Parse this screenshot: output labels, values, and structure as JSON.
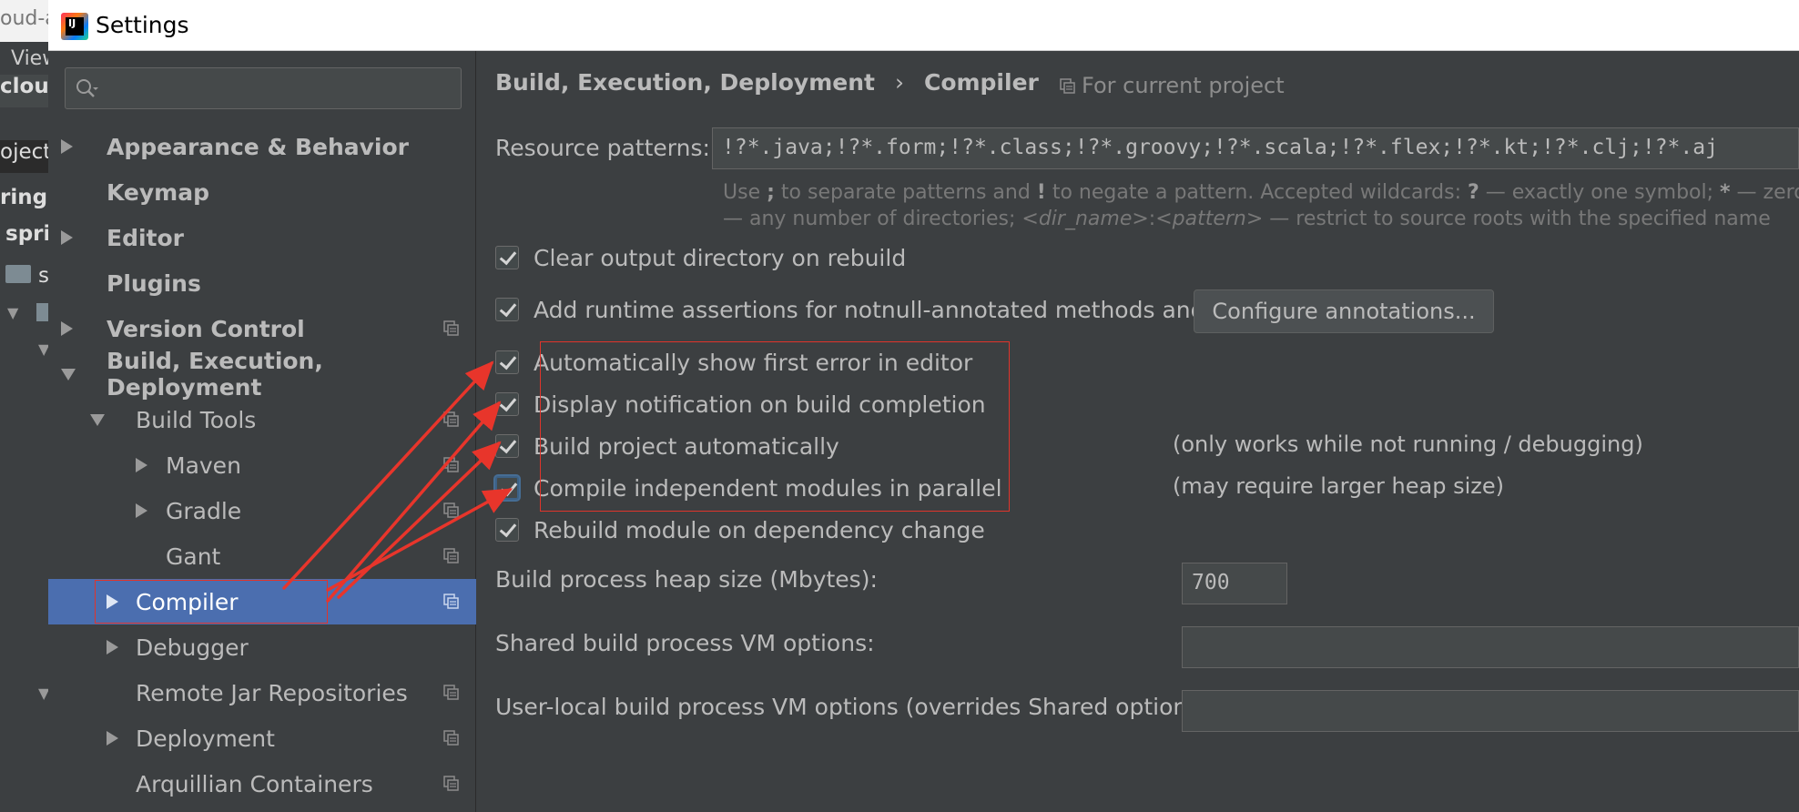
{
  "background_ide": {
    "top_text": "oud-a",
    "menu_item": "View",
    "project_name": "cloud",
    "project_tab": "oject",
    "lines": [
      "ringo",
      "spri",
      "s"
    ]
  },
  "window": {
    "title": "Settings",
    "app_icon_text": "IJ"
  },
  "sidebar": {
    "search_placeholder": "",
    "items": [
      {
        "label": "Appearance & Behavior"
      },
      {
        "label": "Keymap"
      },
      {
        "label": "Editor"
      },
      {
        "label": "Plugins"
      },
      {
        "label": "Version Control"
      },
      {
        "label": "Build, Execution, Deployment"
      },
      {
        "label": "Build Tools"
      },
      {
        "label": "Maven"
      },
      {
        "label": "Gradle"
      },
      {
        "label": "Gant"
      },
      {
        "label": "Compiler"
      },
      {
        "label": "Debugger"
      },
      {
        "label": "Remote Jar Repositories"
      },
      {
        "label": "Deployment"
      },
      {
        "label": "Arquillian Containers"
      }
    ]
  },
  "content": {
    "breadcrumb": {
      "parent": "Build, Execution, Deployment",
      "separator": "›",
      "current": "Compiler"
    },
    "scope_label": "For current project",
    "resource_patterns": {
      "label": "Resource patterns:",
      "value": "!?*.java;!?*.form;!?*.class;!?*.groovy;!?*.scala;!?*.flex;!?*.kt;!?*.clj;!?*.aj",
      "hint_line1_a": "Use ",
      "hint_line1_b": ";",
      "hint_line1_c": " to separate patterns and ",
      "hint_line1_d": "!",
      "hint_line1_e": " to negate a pattern. Accepted wildcards: ",
      "hint_line1_f": "?",
      "hint_line1_g": " — exactly one symbol; ",
      "hint_line1_h": "*",
      "hint_line1_i": " — zero or m",
      "hint_line2_a": "— any number of directories; ",
      "hint_line2_b": "<dir_name>",
      "hint_line2_c": ":",
      "hint_line2_d": "<pattern>",
      "hint_line2_e": " — restrict to source roots with the specified name"
    },
    "options": {
      "clear_output": "Clear output directory on rebuild",
      "runtime_assertions": "Add runtime assertions for notnull-annotated methods and parameters",
      "configure_annotations": "Configure annotations...",
      "show_first_error": "Automatically show first error in editor",
      "display_notification": "Display notification on build completion",
      "build_automatically": "Build project automatically",
      "build_automatically_note": "(only works while not running / debugging)",
      "compile_parallel": "Compile independent modules in parallel",
      "compile_parallel_note": "(may require larger heap size)",
      "rebuild_on_dependency": "Rebuild module on dependency change"
    },
    "heap_size": {
      "label": "Build process heap size (Mbytes):",
      "value": "700"
    },
    "shared_vm": {
      "label": "Shared build process VM options:",
      "value": ""
    },
    "user_vm": {
      "label": "User-local build process VM options (overrides Shared options):",
      "value": ""
    }
  },
  "colors": {
    "background": "#3c3f41",
    "selection": "#4b6eaf",
    "annotation_red": "#e0342b"
  }
}
